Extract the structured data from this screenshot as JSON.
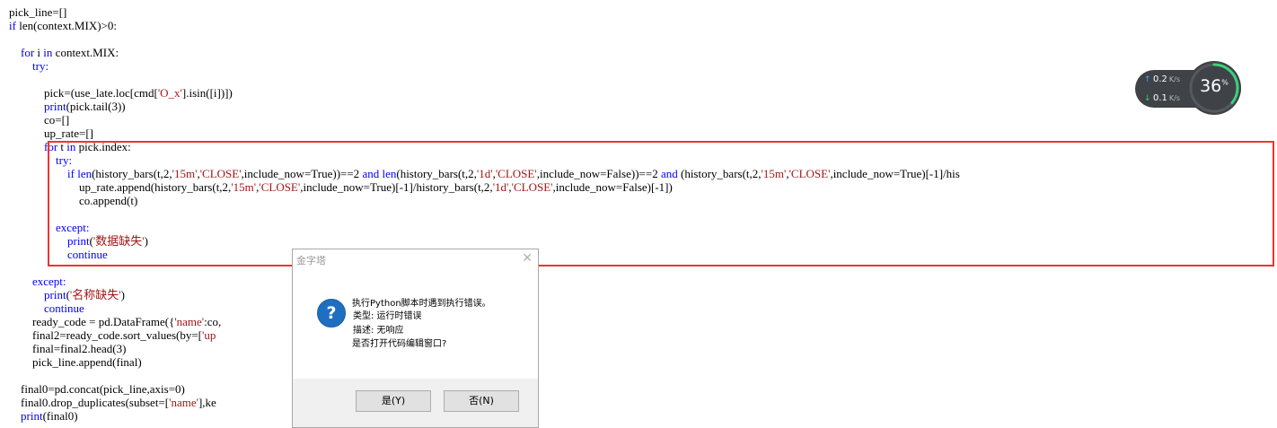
{
  "editor": {
    "lines": [
      [
        {
          "t": "pick_line=[]"
        }
      ],
      [
        {
          "t": "if",
          "c": "kw"
        },
        {
          "t": " len(context.MIX)>0:"
        }
      ],
      [
        {
          "t": ""
        }
      ],
      [
        {
          "t": "    "
        },
        {
          "t": "for",
          "c": "kw"
        },
        {
          "t": " i "
        },
        {
          "t": "in",
          "c": "kw"
        },
        {
          "t": " context.MIX:"
        }
      ],
      [
        {
          "t": "        "
        },
        {
          "t": "try:",
          "c": "kw"
        }
      ],
      [
        {
          "t": ""
        }
      ],
      [
        {
          "t": "            pick=(use_late.loc[cmd["
        },
        {
          "t": "'O_x'",
          "c": "st"
        },
        {
          "t": "].isin([i])])"
        }
      ],
      [
        {
          "t": "            "
        },
        {
          "t": "print",
          "c": "kw"
        },
        {
          "t": "(pick.tail(3))"
        }
      ],
      [
        {
          "t": "            co=[]"
        }
      ],
      [
        {
          "t": "            up_rate=[]"
        }
      ],
      [
        {
          "t": "            "
        },
        {
          "t": "for",
          "c": "kw"
        },
        {
          "t": " t "
        },
        {
          "t": "in",
          "c": "kw"
        },
        {
          "t": " pick.index:"
        }
      ],
      [
        {
          "t": "                "
        },
        {
          "t": "try:",
          "c": "kw"
        }
      ],
      [
        {
          "t": "                    "
        },
        {
          "t": "if",
          "c": "kw"
        },
        {
          "t": " "
        },
        {
          "t": "len",
          "c": "kw"
        },
        {
          "t": "(history_bars(t,2,"
        },
        {
          "t": "'15m'",
          "c": "st"
        },
        {
          "t": ","
        },
        {
          "t": "'CLOSE'",
          "c": "st"
        },
        {
          "t": ",include_now=True))==2 "
        },
        {
          "t": "and",
          "c": "kw"
        },
        {
          "t": " "
        },
        {
          "t": "len",
          "c": "kw"
        },
        {
          "t": "(history_bars(t,2,"
        },
        {
          "t": "'1d'",
          "c": "st"
        },
        {
          "t": ","
        },
        {
          "t": "'CLOSE'",
          "c": "st"
        },
        {
          "t": ",include_now=False))==2 "
        },
        {
          "t": "and",
          "c": "kw"
        },
        {
          "t": " (history_bars(t,2,"
        },
        {
          "t": "'15m'",
          "c": "st"
        },
        {
          "t": ","
        },
        {
          "t": "'CLOSE'",
          "c": "st"
        },
        {
          "t": ",include_now=True)[-1]/his"
        }
      ],
      [
        {
          "t": "                        up_rate.append(history_bars(t,2,"
        },
        {
          "t": "'15m'",
          "c": "st"
        },
        {
          "t": ","
        },
        {
          "t": "'CLOSE'",
          "c": "st"
        },
        {
          "t": ",include_now=True)[-1]/history_bars(t,2,"
        },
        {
          "t": "'1d'",
          "c": "st"
        },
        {
          "t": ","
        },
        {
          "t": "'CLOSE'",
          "c": "st"
        },
        {
          "t": ",include_now=False)[-1])"
        }
      ],
      [
        {
          "t": "                        co.append(t)"
        }
      ],
      [
        {
          "t": ""
        }
      ],
      [
        {
          "t": "                "
        },
        {
          "t": "except:",
          "c": "kw"
        }
      ],
      [
        {
          "t": "                    "
        },
        {
          "t": "print",
          "c": "kw"
        },
        {
          "t": "("
        },
        {
          "t": "'数据缺失'",
          "c": "st"
        },
        {
          "t": ")"
        }
      ],
      [
        {
          "t": "                    "
        },
        {
          "t": "continue",
          "c": "kw"
        }
      ],
      [
        {
          "t": ""
        }
      ],
      [
        {
          "t": "        "
        },
        {
          "t": "except:",
          "c": "kw"
        }
      ],
      [
        {
          "t": "            "
        },
        {
          "t": "print",
          "c": "kw"
        },
        {
          "t": "("
        },
        {
          "t": "'名称缺失'",
          "c": "st"
        },
        {
          "t": ")"
        }
      ],
      [
        {
          "t": "            "
        },
        {
          "t": "continue",
          "c": "kw"
        }
      ],
      [
        {
          "t": "        ready_code = pd.DataFrame({"
        },
        {
          "t": "'name'",
          "c": "st"
        },
        {
          "t": ":co,"
        }
      ],
      [
        {
          "t": "        final2=ready_code.sort_values(by=["
        },
        {
          "t": "'up",
          "c": "st"
        }
      ],
      [
        {
          "t": "        final=final2.head(3)"
        }
      ],
      [
        {
          "t": "        pick_line.append(final)"
        }
      ],
      [
        {
          "t": ""
        }
      ],
      [
        {
          "t": "    final0=pd.concat(pick_line,axis=0)"
        }
      ],
      [
        {
          "t": "    final0.drop_duplicates(subset=["
        },
        {
          "t": "'name'",
          "c": "st"
        },
        {
          "t": "],ke"
        }
      ],
      [
        {
          "t": "    "
        },
        {
          "t": "print",
          "c": "kw"
        },
        {
          "t": "(final0)"
        }
      ]
    ]
  },
  "speed_widget": {
    "upload_value": "0.2",
    "download_value": "0.1",
    "unit": "K/s",
    "percent": "36",
    "percent_symbol": "%",
    "percent_value": 36,
    "up_arrow": "↑",
    "down_arrow": "↓",
    "colors": {
      "up": "#4aa3ff",
      "down": "#3ad27a",
      "ring": "#3ad27a"
    }
  },
  "dialog": {
    "title": "金字塔",
    "close_glyph": "✕",
    "icon_glyph": "?",
    "message_line1": "执行Python脚本时遇到执行错误。",
    "message_line2": "类型: 运行时错误",
    "message_line3": "描述: 无响应",
    "message_line4": "是否打开代码编辑窗口?",
    "yes_label": "是(Y)",
    "no_label": "否(N)"
  },
  "colors": {
    "highlight_border": "#ee3333",
    "keyword": "#0000ff",
    "string": "#a31515"
  }
}
